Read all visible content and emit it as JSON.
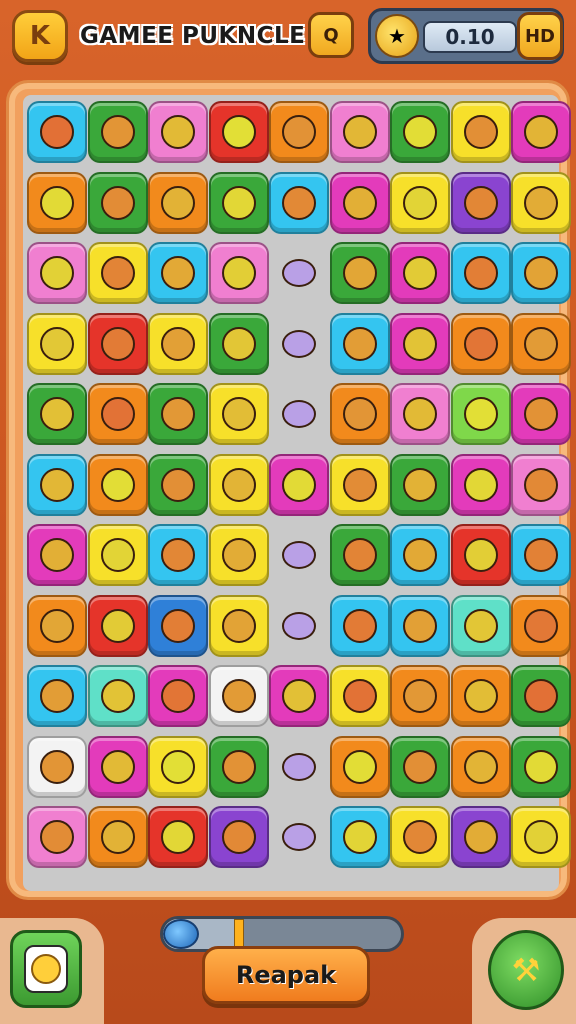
{
  "header": {
    "back_label": "K",
    "title": "GAMEE PUKNCLE",
    "hint_label": "Q",
    "score": "0.10",
    "hd_label": "HD",
    "score_icon": "trophy-bird-icon"
  },
  "board": {
    "columns": 9,
    "rows": 11,
    "colors": {
      "cyan": "#34c5f0",
      "green": "#3aa83a",
      "pink": "#f07fd0",
      "red": "#e5342a",
      "orange": "#f28a1c",
      "yellow": "#f7e02a",
      "magenta": "#e33bbb",
      "blue": "#2f80d8",
      "purple": "#8a44d0",
      "lime": "#7fd84a",
      "teal": "#5fe0c8",
      "white": "#f3f3f3",
      "empty": "#c9c9c9"
    },
    "tiles": [
      [
        "cyan",
        "green",
        "pink",
        "red",
        "orange",
        "pink",
        "green",
        "yellow",
        "magenta"
      ],
      [
        "orange",
        "green",
        "orange",
        "green",
        "cyan",
        "magenta",
        "yellow",
        "purple",
        "yellow"
      ],
      [
        "pink",
        "yellow",
        "cyan",
        "pink",
        "empty",
        "green",
        "magenta",
        "cyan",
        "cyan"
      ],
      [
        "yellow",
        "red",
        "yellow",
        "green",
        "empty",
        "cyan",
        "magenta",
        "orange",
        "orange"
      ],
      [
        "green",
        "orange",
        "green",
        "yellow",
        "empty",
        "orange",
        "pink",
        "lime",
        "magenta"
      ],
      [
        "cyan",
        "orange",
        "green",
        "yellow",
        "magenta",
        "yellow",
        "green",
        "magenta",
        "pink"
      ],
      [
        "magenta",
        "yellow",
        "cyan",
        "yellow",
        "empty",
        "green",
        "cyan",
        "red",
        "cyan"
      ],
      [
        "orange",
        "red",
        "blue",
        "yellow",
        "empty",
        "cyan",
        "cyan",
        "teal",
        "orange"
      ],
      [
        "cyan",
        "teal",
        "magenta",
        "white",
        "magenta",
        "yellow",
        "orange",
        "orange",
        "green"
      ],
      [
        "white",
        "magenta",
        "yellow",
        "green",
        "empty",
        "orange",
        "green",
        "orange",
        "green"
      ],
      [
        "pink",
        "orange",
        "red",
        "purple",
        "empty",
        "cyan",
        "yellow",
        "purple",
        "yellow"
      ]
    ]
  },
  "footer": {
    "repack_label": "Reapak",
    "progress_fraction": 0.32,
    "profile_icon": "profile-card-icon",
    "tool_icon": "hammer-icon"
  }
}
